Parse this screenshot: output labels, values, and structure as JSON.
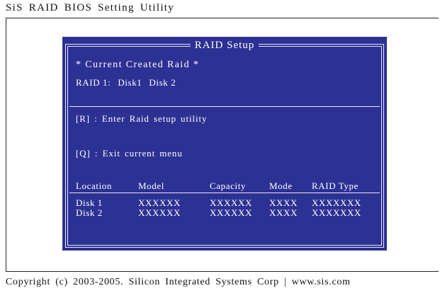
{
  "app": {
    "title": "SiS RAID BIOS Setting Utility",
    "copyright": "Copyright (c) 2003-2005. Silicon Integrated Systems Corp   |   www.sis.com"
  },
  "panel": {
    "title": "RAID Setup",
    "current_heading": "* Current Created Raid *",
    "raid_label": "RAID 1:",
    "raid_disk_a": "Disk1",
    "raid_disk_b": "Disk 2"
  },
  "menu": {
    "items": [
      {
        "key": "[R]",
        "label": ": Enter Raid setup utility"
      },
      {
        "key": "[Q]",
        "label": ": Exit current menu"
      }
    ]
  },
  "table": {
    "columns": [
      "Location",
      "Model",
      "Capacity",
      "Mode",
      "RAID Type"
    ],
    "rows": [
      [
        "Disk 1",
        "XXXXXX",
        "XXXXXX",
        "XXXX",
        "XXXXXXX"
      ],
      [
        "Disk 2",
        "XXXXXX",
        "XXXXXX",
        "XXXX",
        "XXXXXXX"
      ]
    ]
  },
  "colors": {
    "panel_background": "#2c3194",
    "panel_text": "#ffffff",
    "page_background": "#ffffff"
  }
}
